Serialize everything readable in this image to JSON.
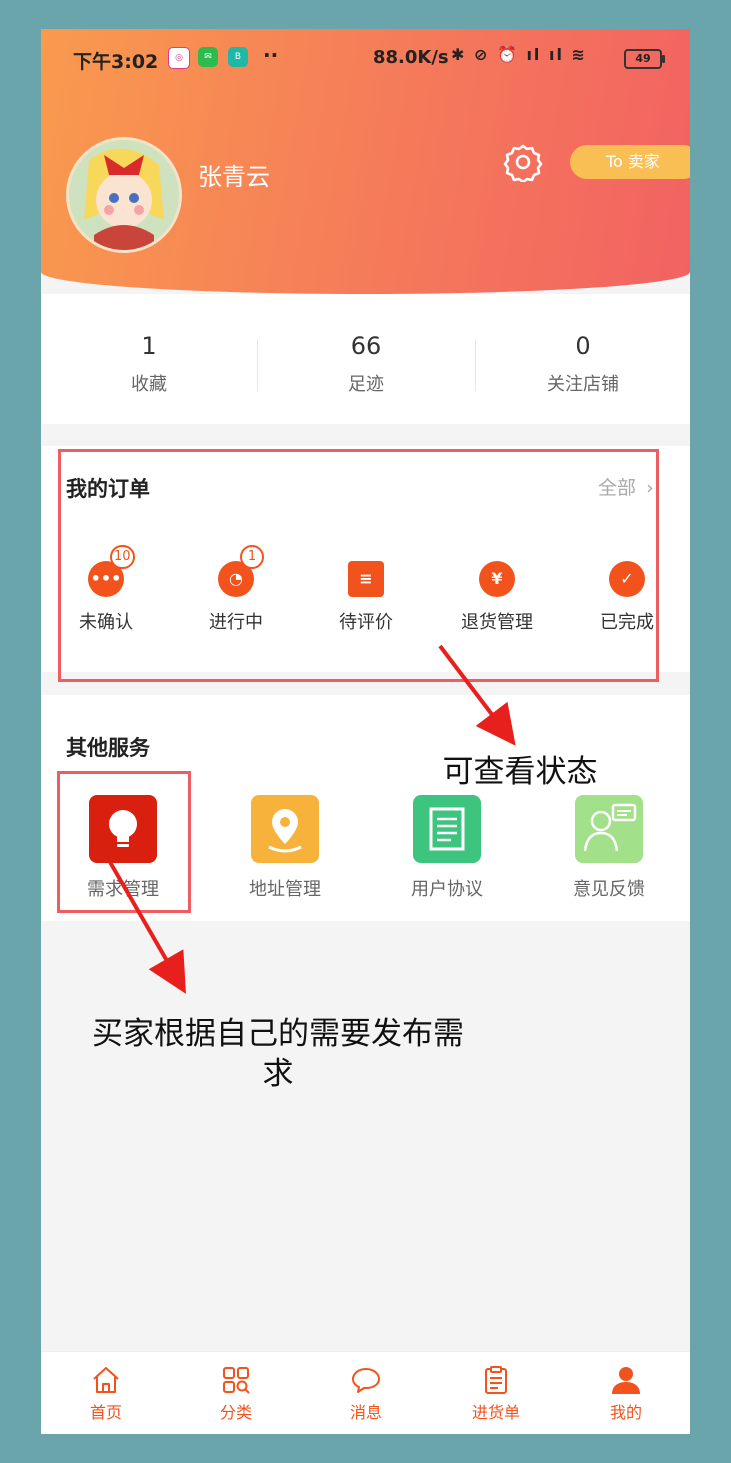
{
  "status_bar": {
    "time": "下午3:02",
    "network_speed": "88.0K/s",
    "battery": "49"
  },
  "profile": {
    "username": "张青云",
    "to_seller_label": "To 卖家"
  },
  "stats": [
    {
      "value": "1",
      "label": "收藏"
    },
    {
      "value": "66",
      "label": "足迹"
    },
    {
      "value": "0",
      "label": "关注店铺"
    }
  ],
  "orders": {
    "title": "我的订单",
    "all_label": "全部",
    "items": [
      {
        "label": "未确认",
        "badge": "10"
      },
      {
        "label": "进行中",
        "badge": "1"
      },
      {
        "label": "待评价"
      },
      {
        "label": "退货管理"
      },
      {
        "label": "已完成"
      }
    ]
  },
  "services": {
    "title": "其他服务",
    "items": [
      {
        "label": "需求管理",
        "color": "#d9200f"
      },
      {
        "label": "地址管理",
        "color": "#f7b23b"
      },
      {
        "label": "用户协议",
        "color": "#3dc47e"
      },
      {
        "label": "意见反馈",
        "color": "#a2e08a"
      }
    ]
  },
  "annotations": {
    "orders_note": "可查看状态",
    "demand_note_line1": "买家根据自己的需要发布需",
    "demand_note_line2": "求"
  },
  "tabbar": [
    {
      "label": "首页"
    },
    {
      "label": "分类"
    },
    {
      "label": "消息"
    },
    {
      "label": "进货单"
    },
    {
      "label": "我的"
    }
  ],
  "colors": {
    "accent": "#f2531d",
    "header_start": "#f99a4e",
    "header_end": "#f26262",
    "annotation_box": "#ee5d62",
    "annotation_arrow": "#e8201d"
  }
}
